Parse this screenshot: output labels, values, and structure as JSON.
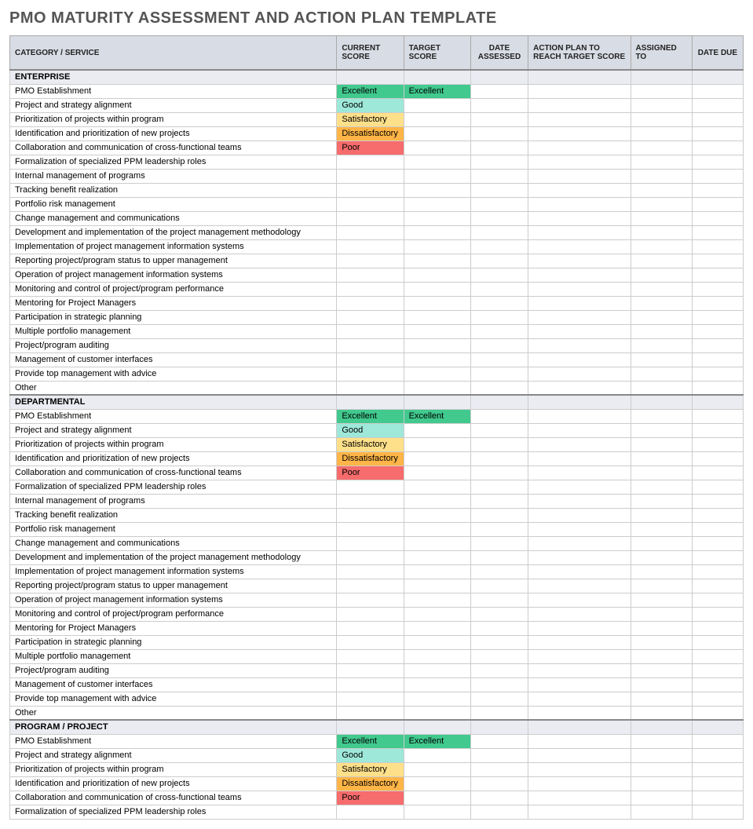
{
  "title": "PMO MATURITY ASSESSMENT AND ACTION PLAN TEMPLATE",
  "columns": {
    "category": "CATEGORY / SERVICE",
    "current": "CURRENT SCORE",
    "target": "TARGET SCORE",
    "dateAssessed": "DATE ASSESSED",
    "plan": "ACTION PLAN TO REACH TARGET SCORE",
    "assigned": "ASSIGNED TO",
    "due": "DATE DUE"
  },
  "serviceNames": [
    "PMO Establishment",
    "Project and strategy alignment",
    "Prioritization of projects within program",
    "Identification and prioritization of new projects",
    "Collaboration and communication of cross-functional teams",
    "Formalization of specialized PPM leadership roles",
    "Internal management of programs",
    "Tracking benefit realization",
    "Portfolio risk management",
    "Change management and communications",
    "Development and implementation of the project management methodology",
    "Implementation of project management information systems",
    "Reporting project/program status to upper management",
    "Operation of project management information systems",
    "Monitoring and control of project/program performance",
    "Mentoring for Project Managers",
    "Participation in strategic planning",
    "Multiple portfolio management",
    "Project/program auditing",
    "Management of customer interfaces",
    "Provide top management with advice",
    "Other"
  ],
  "sections": [
    {
      "name": "ENTERPRISE",
      "rows": [
        {
          "current": "Excellent",
          "target": "Excellent"
        },
        {
          "current": "Good",
          "target": ""
        },
        {
          "current": "Satisfactory",
          "target": ""
        },
        {
          "current": "Dissatisfactory",
          "target": ""
        },
        {
          "current": "Poor",
          "target": ""
        },
        {
          "current": "",
          "target": ""
        },
        {
          "current": "",
          "target": ""
        },
        {
          "current": "",
          "target": ""
        },
        {
          "current": "",
          "target": ""
        },
        {
          "current": "",
          "target": ""
        },
        {
          "current": "",
          "target": ""
        },
        {
          "current": "",
          "target": ""
        },
        {
          "current": "",
          "target": ""
        },
        {
          "current": "",
          "target": ""
        },
        {
          "current": "",
          "target": ""
        },
        {
          "current": "",
          "target": ""
        },
        {
          "current": "",
          "target": ""
        },
        {
          "current": "",
          "target": ""
        },
        {
          "current": "",
          "target": ""
        },
        {
          "current": "",
          "target": ""
        },
        {
          "current": "",
          "target": ""
        },
        {
          "current": "",
          "target": ""
        }
      ]
    },
    {
      "name": "DEPARTMENTAL",
      "rows": [
        {
          "current": "Excellent",
          "target": "Excellent"
        },
        {
          "current": "Good",
          "target": ""
        },
        {
          "current": "Satisfactory",
          "target": ""
        },
        {
          "current": "Dissatisfactory",
          "target": ""
        },
        {
          "current": "Poor",
          "target": ""
        },
        {
          "current": "",
          "target": ""
        },
        {
          "current": "",
          "target": ""
        },
        {
          "current": "",
          "target": ""
        },
        {
          "current": "",
          "target": ""
        },
        {
          "current": "",
          "target": ""
        },
        {
          "current": "",
          "target": ""
        },
        {
          "current": "",
          "target": ""
        },
        {
          "current": "",
          "target": ""
        },
        {
          "current": "",
          "target": ""
        },
        {
          "current": "",
          "target": ""
        },
        {
          "current": "",
          "target": ""
        },
        {
          "current": "",
          "target": ""
        },
        {
          "current": "",
          "target": ""
        },
        {
          "current": "",
          "target": ""
        },
        {
          "current": "",
          "target": ""
        },
        {
          "current": "",
          "target": ""
        },
        {
          "current": "",
          "target": ""
        }
      ]
    },
    {
      "name": "PROGRAM / PROJECT",
      "rows": [
        {
          "current": "Excellent",
          "target": "Excellent"
        },
        {
          "current": "Good",
          "target": ""
        },
        {
          "current": "Satisfactory",
          "target": ""
        },
        {
          "current": "Dissatisfactory",
          "target": ""
        },
        {
          "current": "Poor",
          "target": ""
        },
        {
          "current": "",
          "target": ""
        }
      ]
    }
  ]
}
